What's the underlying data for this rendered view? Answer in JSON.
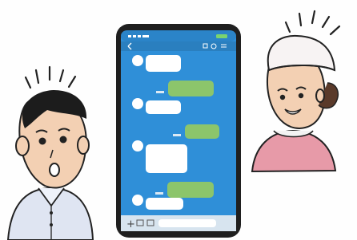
{
  "colors": {
    "phone_frame": "#1f1f1f",
    "phone_screen": "#2f8fd8",
    "incoming_bubble": "#ffffff",
    "outgoing_bubble": "#8cc56b",
    "boy_shirt": "#dfe5f2",
    "boy_hair": "#1c1c1c",
    "girl_shirt": "#e79aa8",
    "girl_cap": "#f7f3f3",
    "skin": "#f3d0b3",
    "line": "#222222"
  },
  "illustration": {
    "boy_expression": "surprised",
    "girl_expression": "smiling",
    "shock_lines": true
  },
  "phone": {
    "messages": [
      {
        "side": "incoming",
        "has_avatar": true
      },
      {
        "side": "outgoing",
        "has_avatar": false
      },
      {
        "side": "incoming",
        "has_avatar": true
      },
      {
        "side": "outgoing",
        "has_avatar": false
      },
      {
        "side": "incoming",
        "has_avatar": true
      },
      {
        "side": "outgoing",
        "has_avatar": false
      },
      {
        "side": "incoming",
        "has_avatar": true
      }
    ]
  }
}
